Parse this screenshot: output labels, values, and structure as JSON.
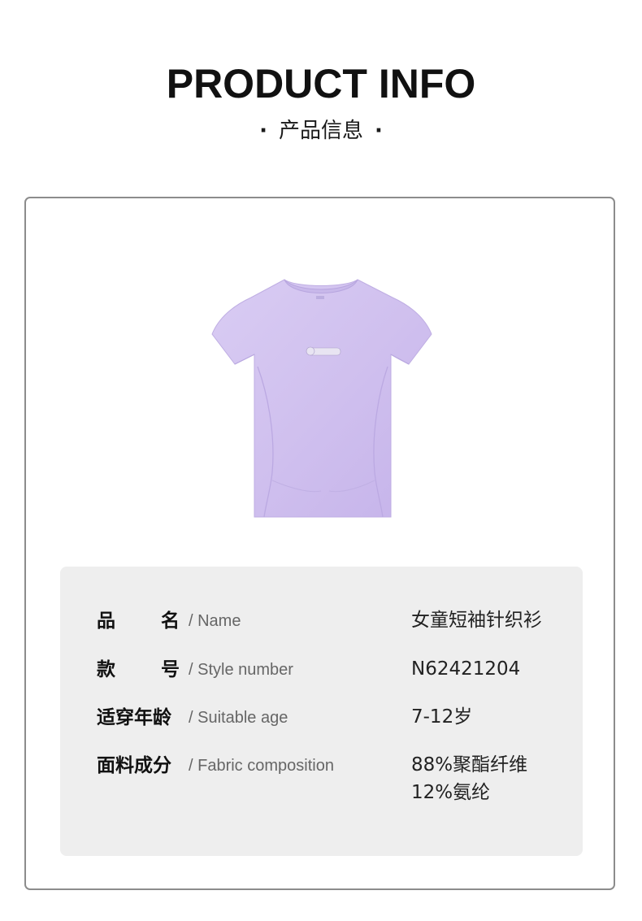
{
  "header": {
    "title": "PRODUCT INFO",
    "subtitle": "产品信息",
    "dot": "·"
  },
  "product": {
    "image": "purple-tshirt",
    "shirt_color": "#d5c6f0"
  },
  "info": {
    "rows": [
      {
        "label_zh_chars": [
          "品",
          "名"
        ],
        "label_en": "/ Name",
        "value_lines": [
          "女童短袖针织衫"
        ]
      },
      {
        "label_zh_chars": [
          "款",
          "号"
        ],
        "label_en": "/ Style number",
        "value_lines": [
          "N62421204"
        ]
      },
      {
        "label_zh": "适穿年龄",
        "label_en": "/ Suitable age",
        "value_lines": [
          "7-12岁"
        ]
      },
      {
        "label_zh": "面料成分",
        "label_en": "/ Fabric composition",
        "value_lines": [
          "88%聚酯纤维",
          "12%氨纶"
        ]
      }
    ]
  }
}
